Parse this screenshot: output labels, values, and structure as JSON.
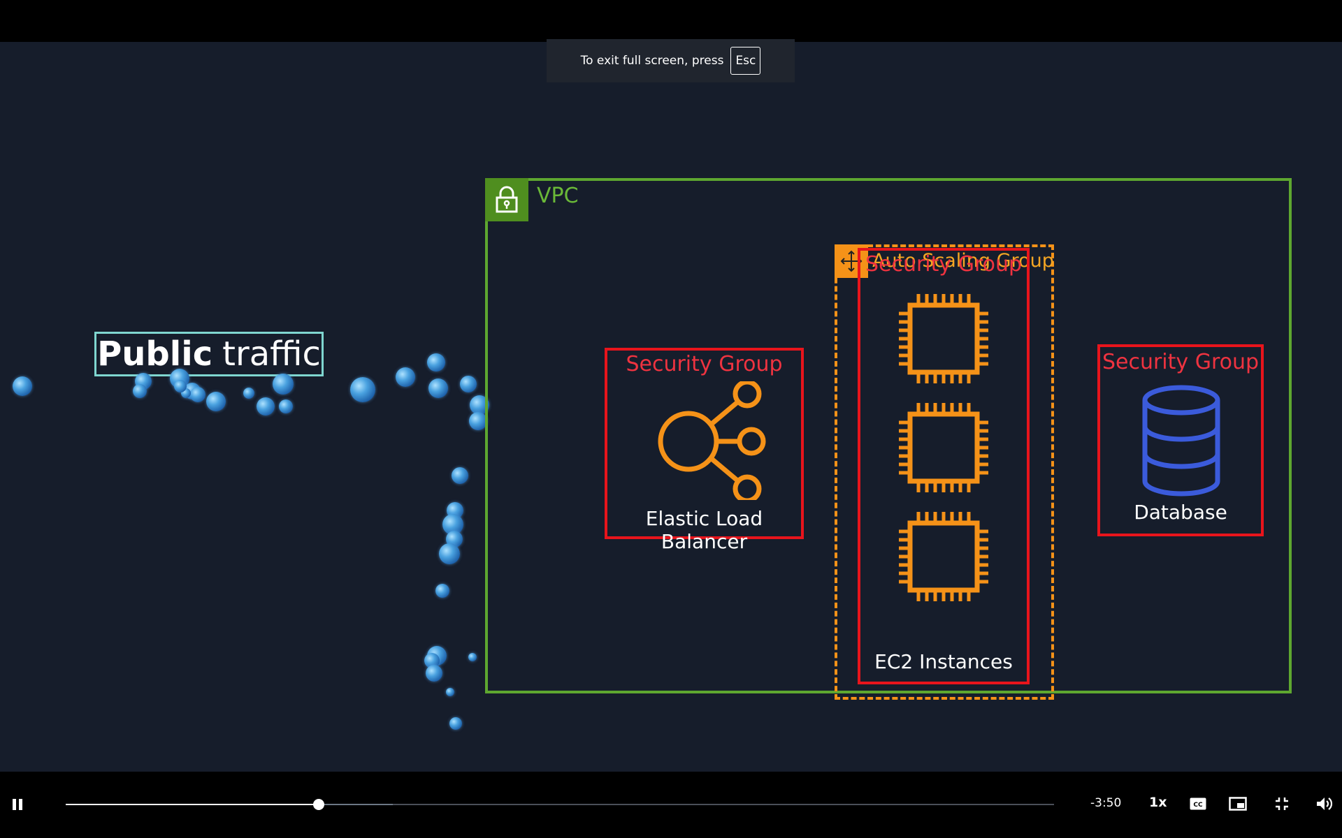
{
  "notice": {
    "text": "To exit full screen, press",
    "key": "Esc"
  },
  "diagram": {
    "public_traffic_bold": "Public",
    "public_traffic_rest": "traffic",
    "vpc_label": "VPC",
    "elb": {
      "group_title": "Security Group",
      "label": "Elastic Load Balancer"
    },
    "asg_label": "Auto Scaling Group",
    "ec2": {
      "group_title": "Security Group",
      "label": "EC2 Instances"
    },
    "db": {
      "group_title": "Security Group",
      "label": "Database"
    }
  },
  "player": {
    "time_remaining": "-3:50",
    "playback_speed": "1x",
    "progress_fraction": 0.256,
    "buffered_fraction": 0.331,
    "icons": {
      "pause": "pause-icon",
      "captions": "closed-captions-icon",
      "pip": "picture-in-picture-icon",
      "exit_fullscreen": "exit-fullscreen-icon",
      "volume": "volume-icon"
    }
  },
  "colors": {
    "vpc": "#5ea730",
    "security_group": "#e8141c",
    "auto_scaling": "#f59218",
    "database": "#3b5bdb",
    "public_traffic_border": "#7fd6d0"
  }
}
